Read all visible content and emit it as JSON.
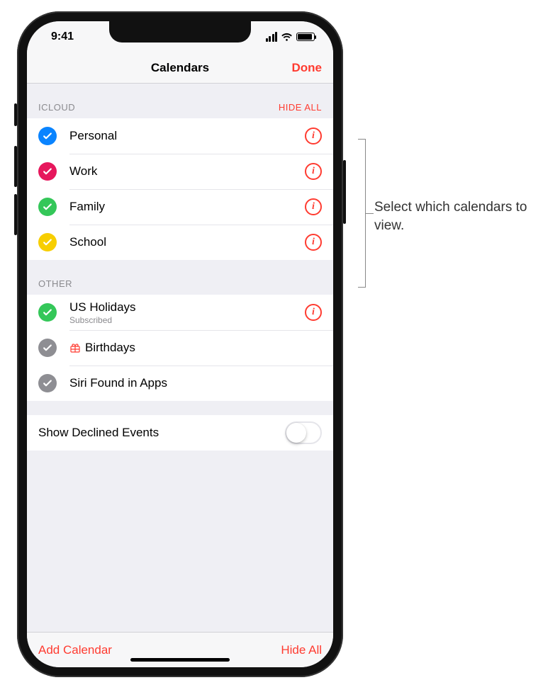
{
  "status": {
    "time": "9:41"
  },
  "nav": {
    "title": "Calendars",
    "done": "Done"
  },
  "sections": {
    "icloud": {
      "header": "ICLOUD",
      "hide": "HIDE ALL",
      "items": [
        {
          "label": "Personal",
          "color": "#0a84ff"
        },
        {
          "label": "Work",
          "color": "#e6175c"
        },
        {
          "label": "Family",
          "color": "#34c759"
        },
        {
          "label": "School",
          "color": "#f7ce00"
        }
      ]
    },
    "other": {
      "header": "OTHER",
      "items": [
        {
          "label": "US Holidays",
          "sublabel": "Subscribed",
          "color": "#34c759",
          "info": true
        },
        {
          "label": "Birthdays",
          "color": "#8e8e93",
          "gift": true
        },
        {
          "label": "Siri Found in Apps",
          "color": "#8e8e93"
        }
      ]
    }
  },
  "declined": {
    "label": "Show Declined Events",
    "on": false
  },
  "footer": {
    "add": "Add Calendar",
    "hide": "Hide All"
  },
  "callout": {
    "text": "Select which calendars to view."
  }
}
